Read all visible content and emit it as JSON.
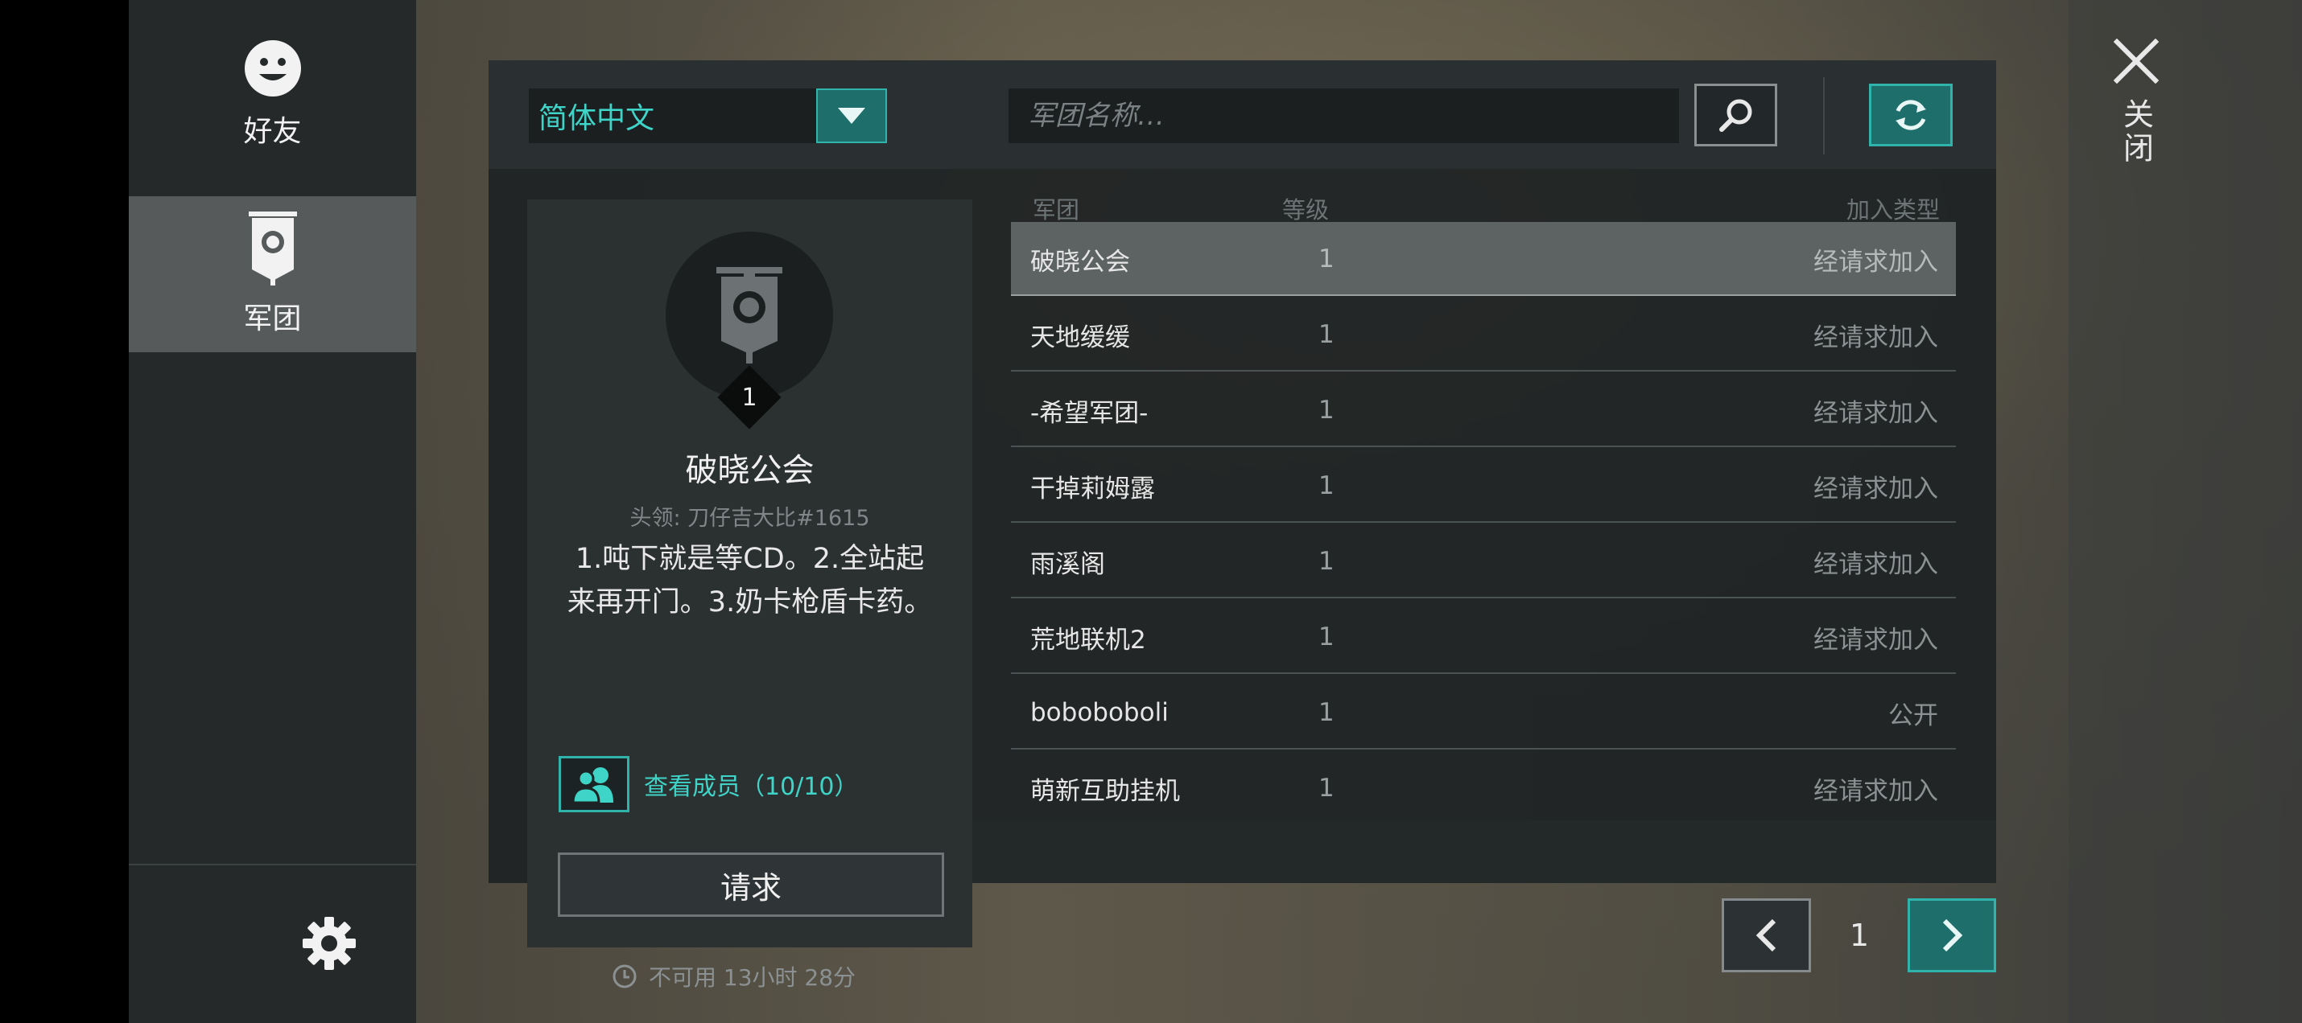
{
  "sidebar": {
    "items": [
      {
        "label": "好友",
        "icon": "smiley-face-icon"
      },
      {
        "label": "军团",
        "icon": "guild-banner-icon",
        "active": true
      }
    ],
    "settings_icon": "gear-icon"
  },
  "close": {
    "label": "关闭",
    "icon": "close-x-icon"
  },
  "toolbar": {
    "language": "简体中文",
    "search_placeholder": "军团名称…"
  },
  "guild_detail": {
    "level": "1",
    "name": "破晓公会",
    "leader": "头领: 刀仔吉大比#1615",
    "description": "1.吨下就是等CD。2.全站起来再开门。3.奶卡枪盾卡药。",
    "members_label": "查看成员（10/10）",
    "request_label": "请求",
    "cooldown_text": "不可用 13小时 28分"
  },
  "table": {
    "headers": {
      "name": "军团",
      "level": "等级",
      "join_type": "加入类型"
    },
    "rows": [
      {
        "name": "破晓公会",
        "level": "1",
        "join_type": "经请求加入",
        "selected": true
      },
      {
        "name": "天地缓缓",
        "level": "1",
        "join_type": "经请求加入"
      },
      {
        "name": "-希望军团-",
        "level": "1",
        "join_type": "经请求加入"
      },
      {
        "name": "干掉莉姆露",
        "level": "1",
        "join_type": "经请求加入"
      },
      {
        "name": "雨溪阁",
        "level": "1",
        "join_type": "经请求加入"
      },
      {
        "name": "荒地联机2",
        "level": "1",
        "join_type": "经请求加入"
      },
      {
        "name": "boboboboli",
        "level": "1",
        "join_type": "公开"
      },
      {
        "name": "萌新互助挂机",
        "level": "1",
        "join_type": "经请求加入"
      }
    ]
  },
  "pager": {
    "page": "1"
  },
  "colors": {
    "accent": "#2fb3aa",
    "accent_fill": "#1e6e6b",
    "accent_text": "#3fd4c8"
  }
}
